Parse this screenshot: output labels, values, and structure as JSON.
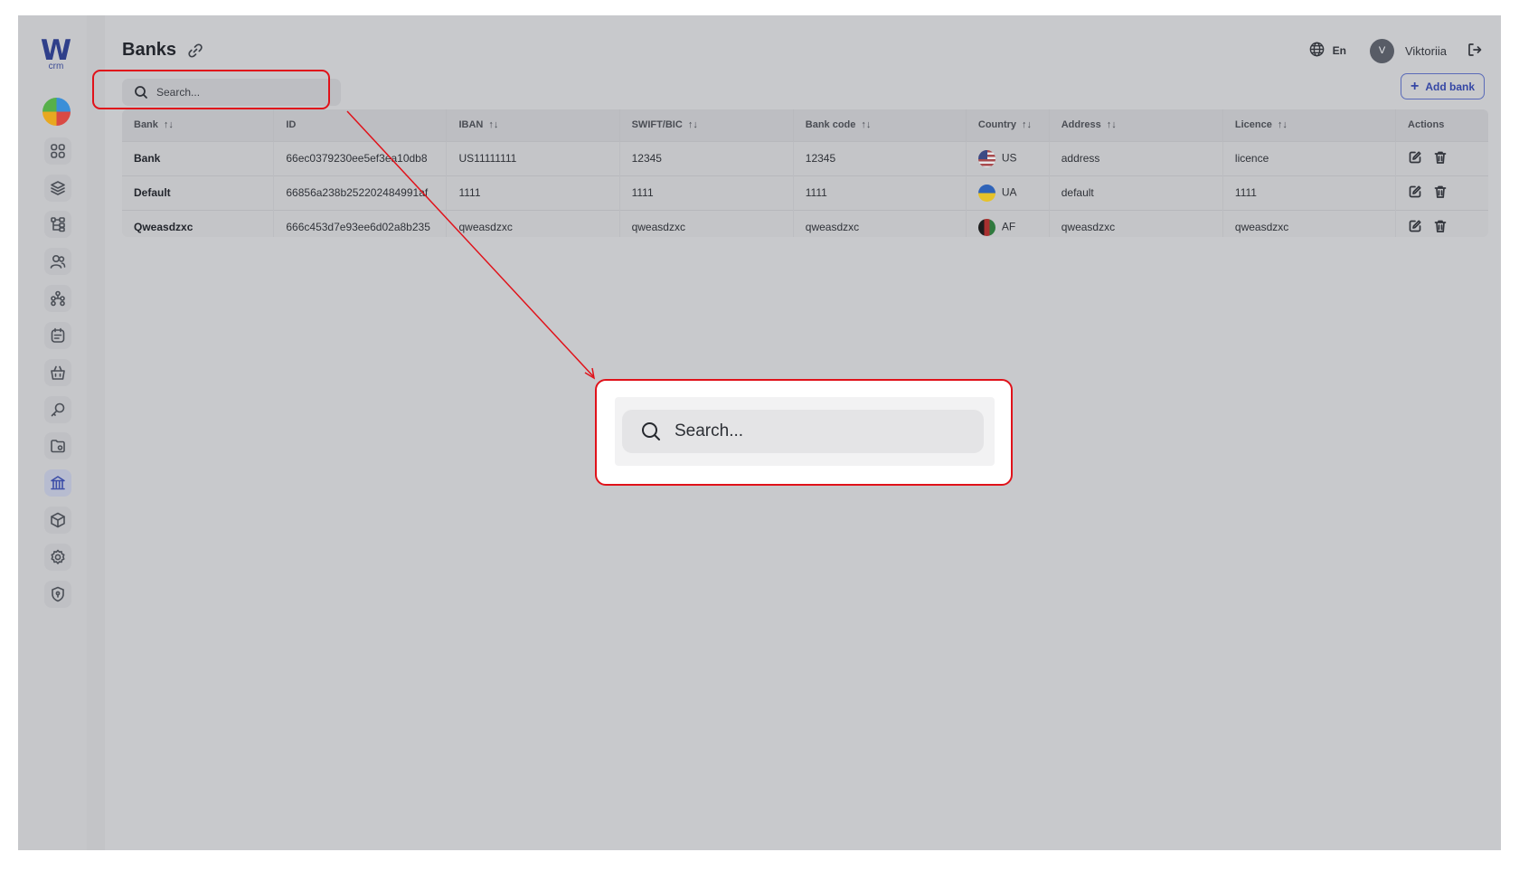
{
  "logo": {
    "letter": "W",
    "sub": "crm"
  },
  "header": {
    "title": "Banks",
    "language": "En",
    "avatar_initial": "V",
    "username": "Viktoriia"
  },
  "search": {
    "placeholder": "Search..."
  },
  "add_bank": {
    "label": "Add bank"
  },
  "table": {
    "columns": [
      "Bank",
      "ID",
      "IBAN",
      "SWIFT/BIC",
      "Bank code",
      "Country",
      "Address",
      "Licence",
      "Actions"
    ],
    "sortable": [
      true,
      false,
      true,
      true,
      true,
      true,
      true,
      true,
      false
    ],
    "sort_glyph": "↑↓",
    "rows": [
      {
        "bank": "Bank",
        "id": "66ec0379230ee5ef3ea10db8",
        "iban": "US11111111",
        "swift": "12345",
        "bank_code": "12345",
        "country": "US",
        "address": "address",
        "licence": "licence"
      },
      {
        "bank": "Default",
        "id": "66856a238b252202484991af",
        "iban": "1111",
        "swift": "1111",
        "bank_code": "1111",
        "country": "UA",
        "address": "default",
        "licence": "1111"
      },
      {
        "bank": "Qweasdzxc",
        "id": "666c453d7e93ee6d02a8b235",
        "iban": "qweasdzxc",
        "swift": "qweasdzxc",
        "bank_code": "qweasdzxc",
        "country": "AF",
        "address": "qweasdzxc",
        "licence": "qweasdzxc"
      }
    ]
  },
  "sidebar": {
    "items": [
      "dashboard-icon",
      "layers-icon",
      "structure-icon",
      "users-icon",
      "network-icon",
      "notes-icon",
      "basket-icon",
      "key-icon",
      "folder-icon",
      "bank-icon",
      "cube-icon",
      "settings-icon",
      "shield-icon"
    ],
    "active": "bank-icon"
  },
  "annotation": {
    "zoom_text": "Search...",
    "color": "#e0121a"
  }
}
